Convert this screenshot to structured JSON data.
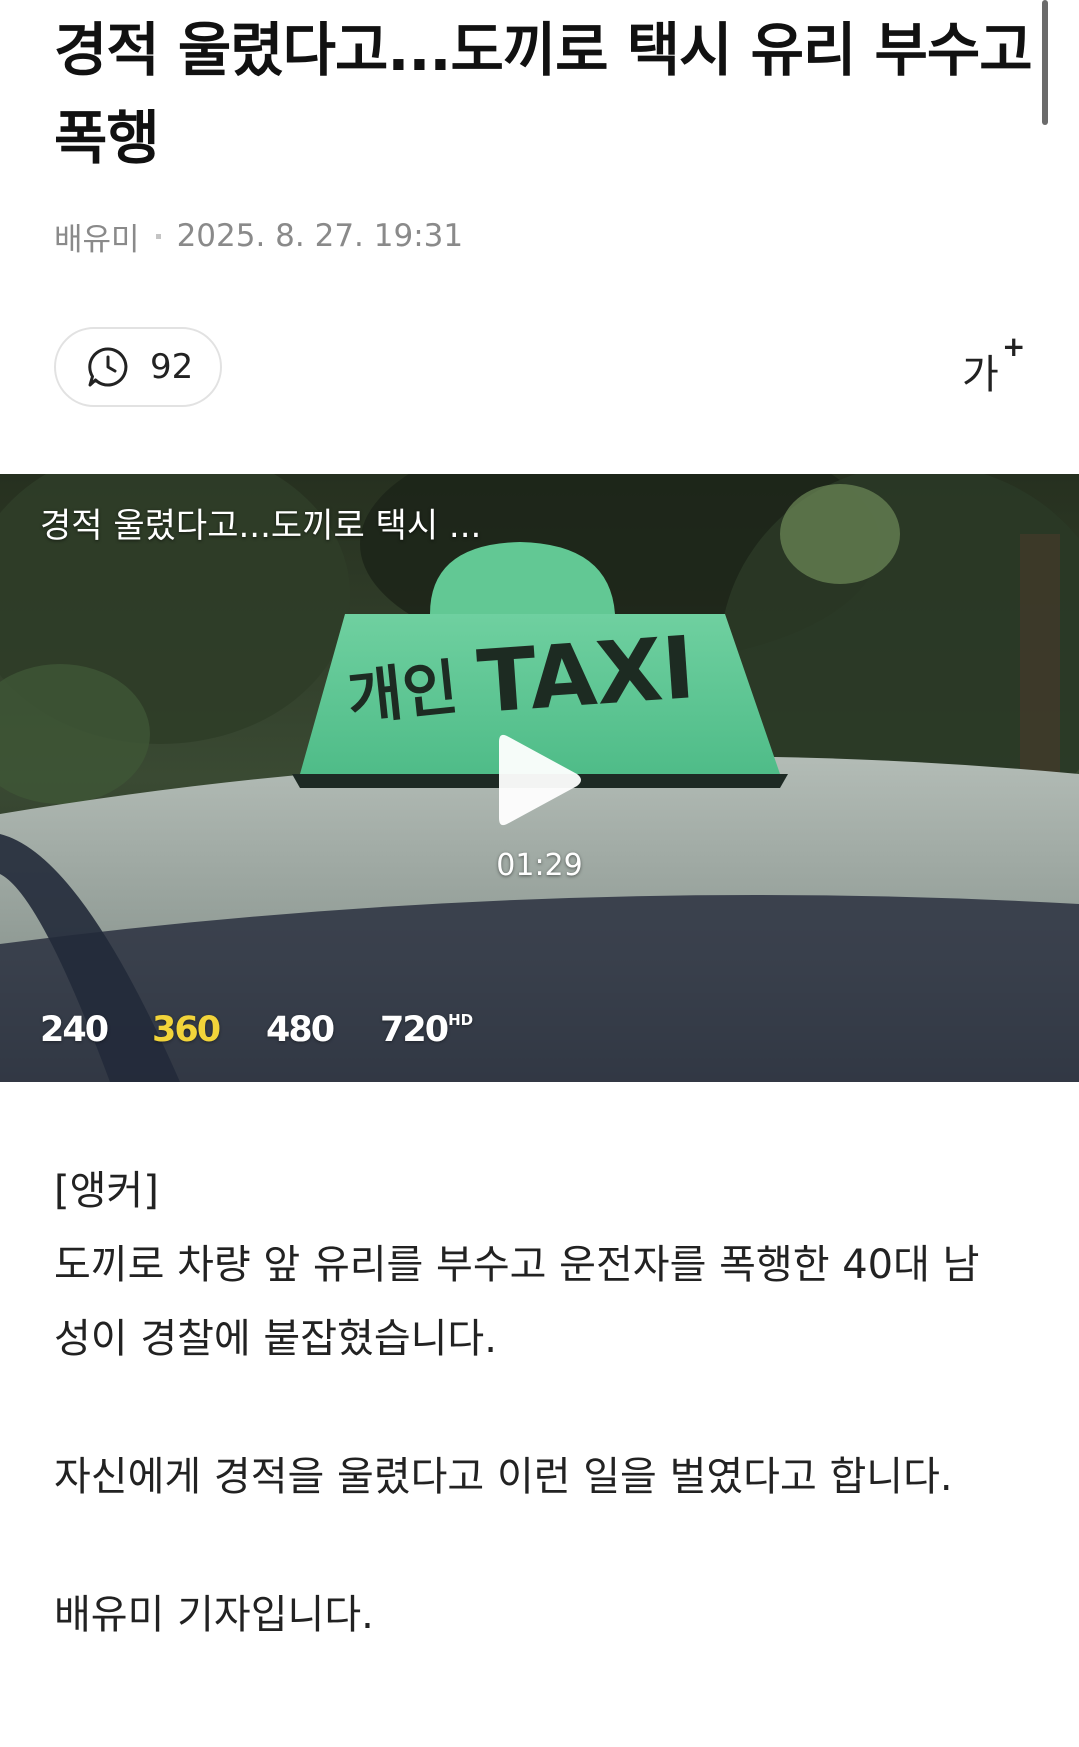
{
  "article": {
    "headline": "경적 울렸다고...도끼로 택시 유리 부수고 폭행",
    "reporter": "배유미",
    "published": "2025. 8. 27. 19:31"
  },
  "toolbar": {
    "comment_icon": "comment-icon",
    "comment_count": "92",
    "font_size_label": "가",
    "font_size_plus": "+"
  },
  "video": {
    "title": "경적 울렸다고...도끼로 택시 ...",
    "duration": "01:29",
    "sign_left": "개인",
    "sign_right": "TAXI",
    "play_icon": "play-icon",
    "qualities": [
      {
        "label": "240",
        "badge": ""
      },
      {
        "label": "360",
        "badge": ""
      },
      {
        "label": "480",
        "badge": ""
      },
      {
        "label": "720",
        "badge": "HD"
      }
    ],
    "selected_quality": "360",
    "selected_color": "#f2d43a"
  },
  "body": {
    "anchor_tag": "[앵커]",
    "paragraph_1": "도끼로 차량 앞 유리를 부수고 운전자를 폭행한 40대 남성이 경찰에 붙잡혔습니다.",
    "paragraph_2": "자신에게 경적을 울렸다고 이런 일을 벌였다고 합니다.",
    "paragraph_3": "배유미 기자입니다."
  }
}
